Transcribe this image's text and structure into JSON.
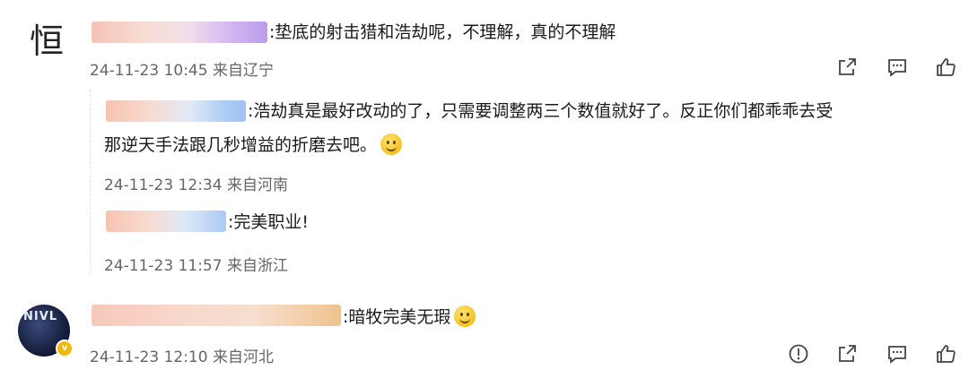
{
  "comments": [
    {
      "avatar_text": "恒",
      "text": ":垫底的射击猎和浩劫呢，不理解，真的不理解",
      "meta": "24-11-23 10:45 来自辽宁",
      "actions": [
        "share-icon",
        "comment-icon",
        "like-icon"
      ],
      "replies": [
        {
          "text_line1": ":浩劫真是最好改动的了，只需要调整两三个数值就好了。反正你们都乖乖去受",
          "text_line2": "那逆天手法跟几秒增益的折磨去吧。",
          "meta": "24-11-23 12:34 来自河南",
          "emoji": "smile-emoji"
        },
        {
          "text": ":完美职业!",
          "meta": "24-11-23 11:57 来自浙江"
        }
      ]
    },
    {
      "avatar_text": "NIVL",
      "text": ":暗牧完美无瑕",
      "meta": "24-11-23 12:10 来自河北",
      "emoji": "smile-emoji",
      "actions": [
        "report-icon",
        "share-icon",
        "comment-icon",
        "like-icon"
      ]
    }
  ],
  "colors": {
    "text": "#1a1a1a",
    "meta": "#666666",
    "icon": "#444444",
    "verify_badge": "#f2b807"
  }
}
